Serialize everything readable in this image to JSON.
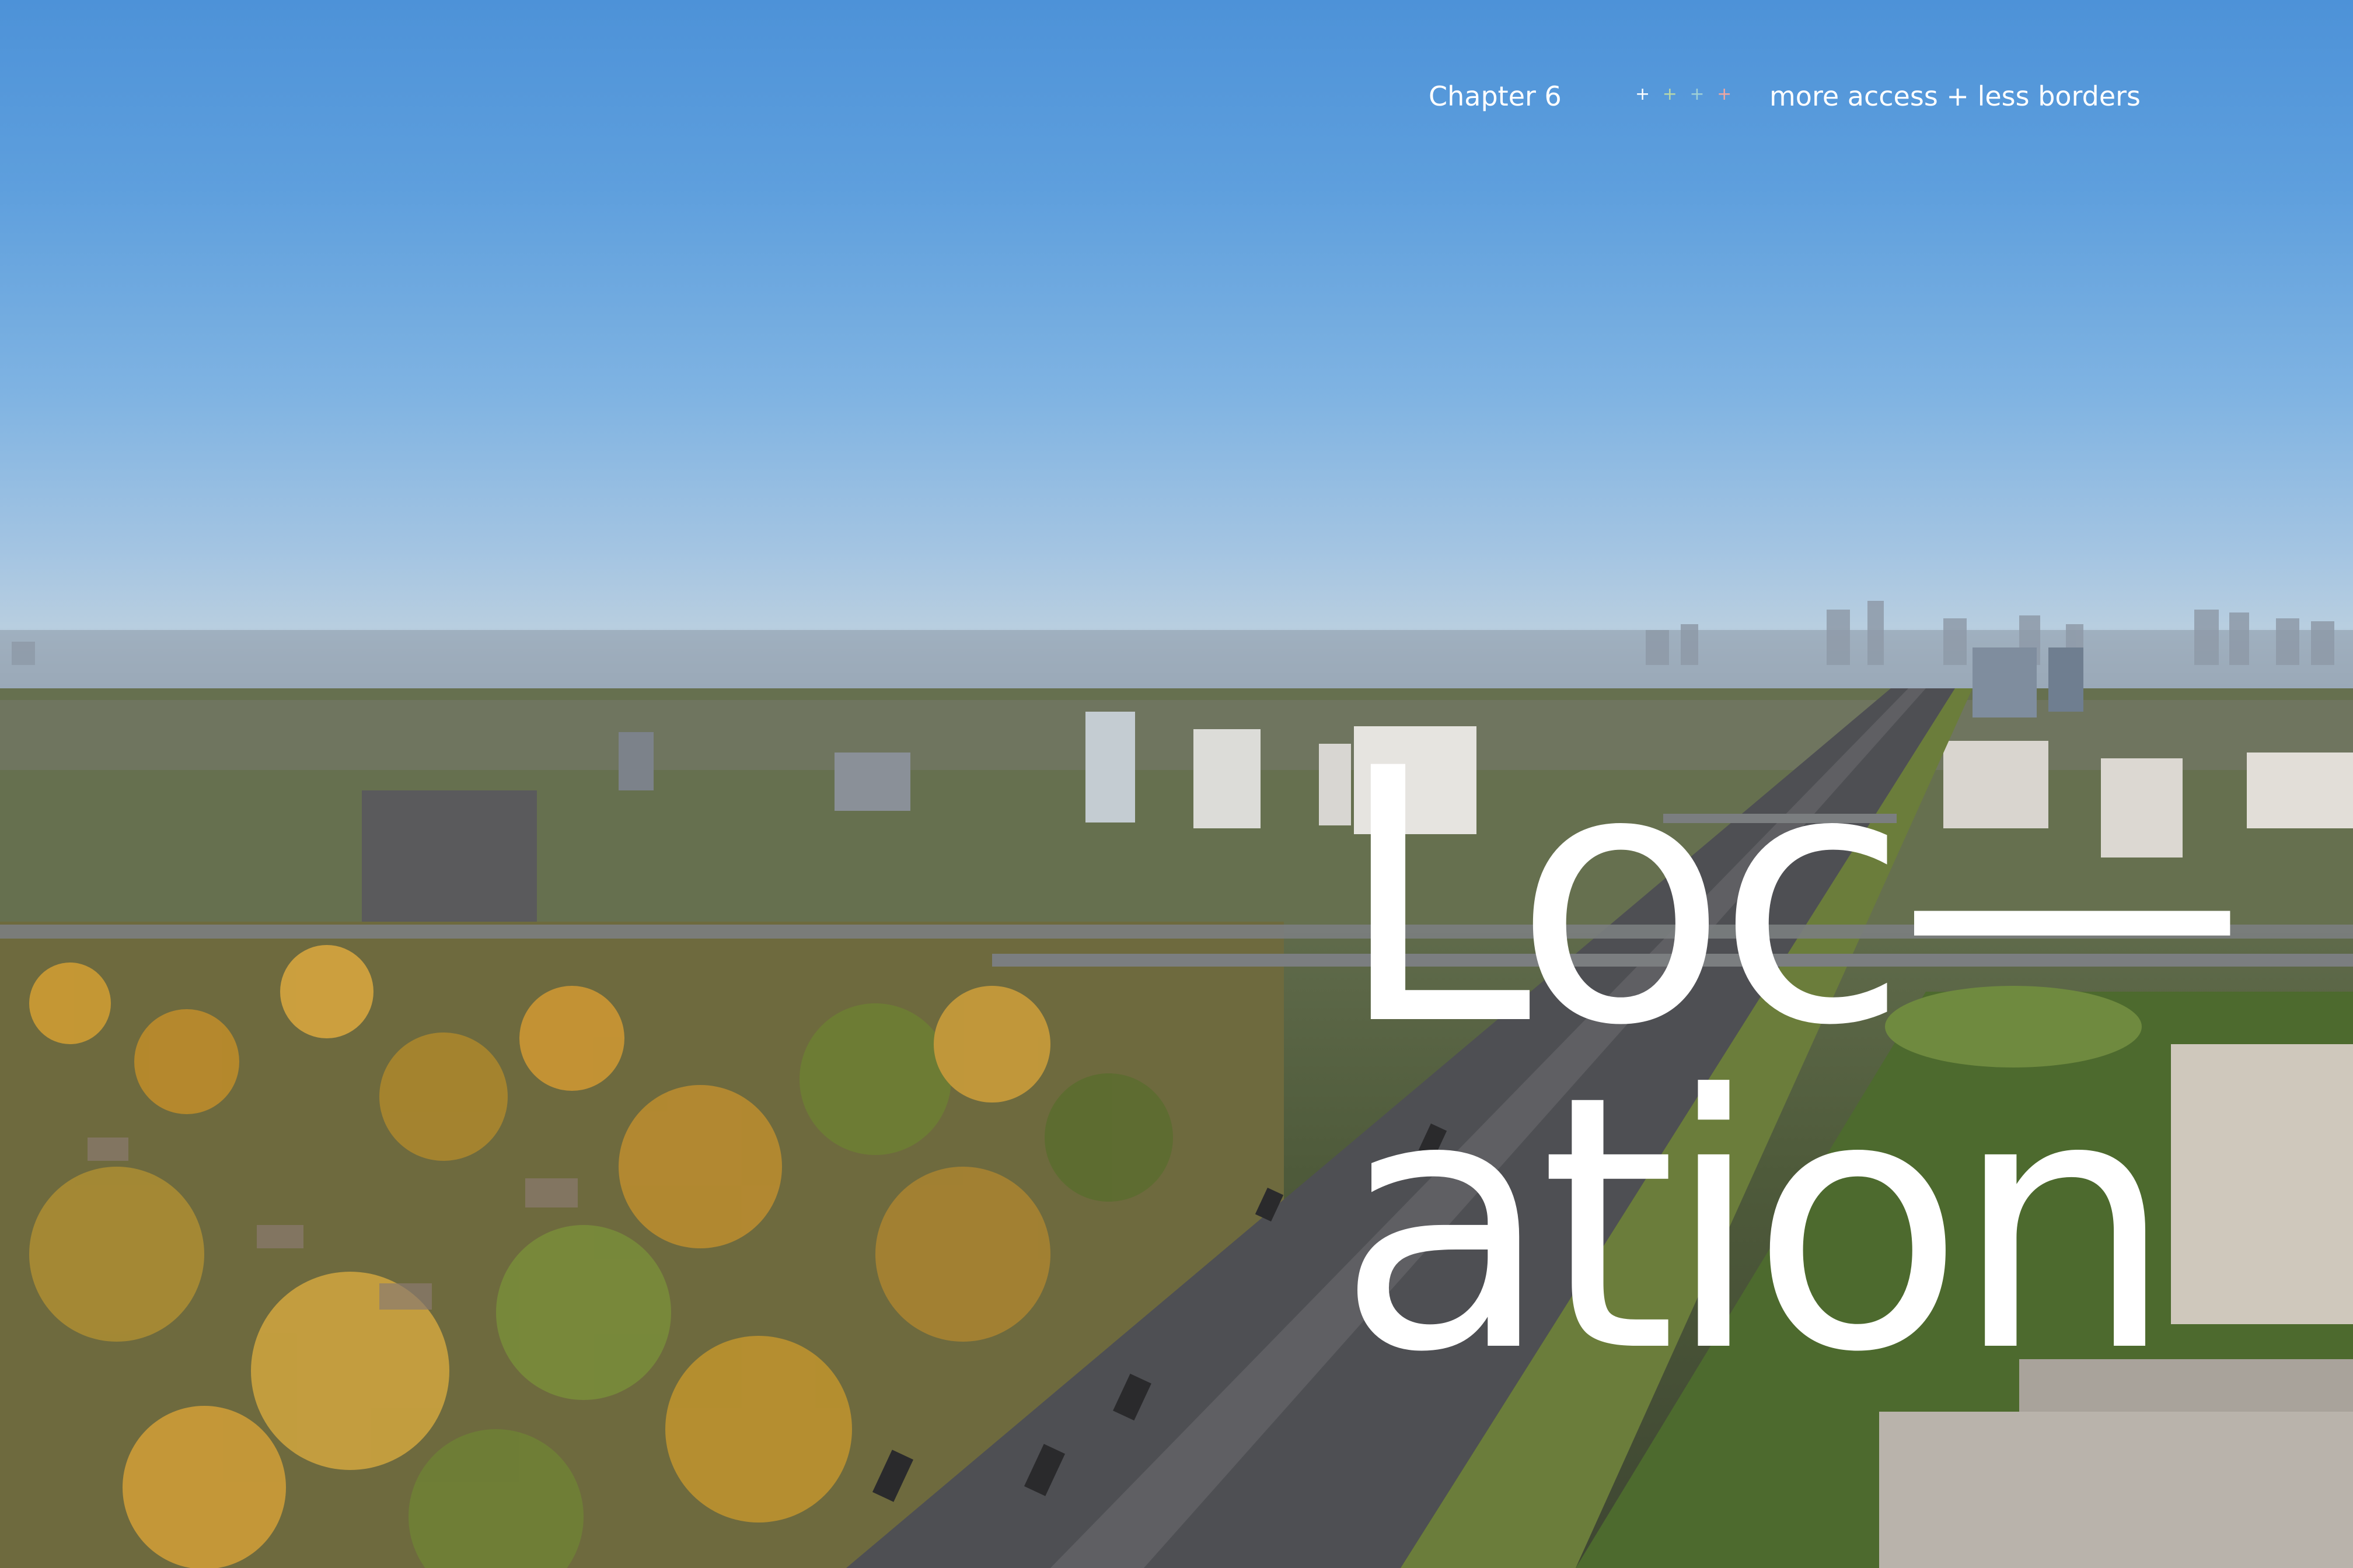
{
  "header": {
    "chapter": "Chapter 6",
    "separator": [
      "+",
      "+",
      "+",
      "+"
    ],
    "separator_colors": [
      "#ffffff",
      "#b9d7a8",
      "#9fd0d6",
      "#f0a6a0"
    ],
    "tagline": "more access + less borders"
  },
  "title": {
    "line1": "Loc—",
    "line2": "ation"
  },
  "photo": {
    "subject": "aerial-city-highway-autumn",
    "colors": {
      "sky_top": "#4d92d8",
      "sky_haze": "#b8cee0",
      "trees_autumn": "#c89a3a",
      "trees_green": "#4f6a2e",
      "road": "#55565a",
      "building": "#cfcac0"
    }
  }
}
